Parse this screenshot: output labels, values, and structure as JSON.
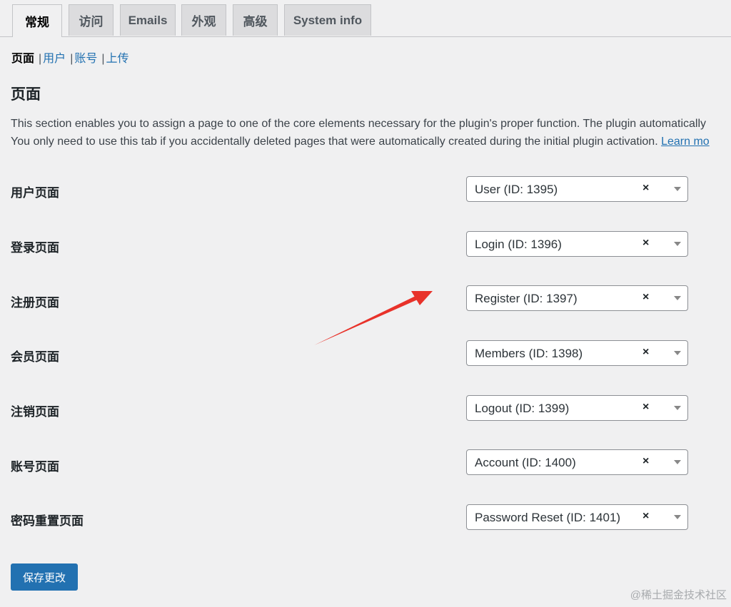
{
  "tabs": [
    "常规",
    "访问",
    "Emails",
    "外观",
    "高级",
    "System info"
  ],
  "subnav": {
    "current": "页面",
    "links": [
      "用户",
      "账号",
      "上传"
    ],
    "separator": "|"
  },
  "section": {
    "title": "页面",
    "desc_line1": "This section enables you to assign a page to one of the core elements necessary for the plugin's proper function. The plugin automatically",
    "desc_line2": "You only need to use this tab if you accidentally deleted pages that were automatically created during the initial plugin activation.",
    "learn_more": "Learn mo"
  },
  "rows": [
    {
      "label": "用户页面",
      "value": "User (ID: 1395)"
    },
    {
      "label": "登录页面",
      "value": "Login (ID: 1396)"
    },
    {
      "label": "注册页面",
      "value": "Register (ID: 1397)"
    },
    {
      "label": "会员页面",
      "value": "Members (ID: 1398)"
    },
    {
      "label": "注销页面",
      "value": "Logout (ID: 1399)"
    },
    {
      "label": "账号页面",
      "value": "Account (ID: 1400)"
    },
    {
      "label": "密码重置页面",
      "value": "Password Reset (ID: 1401)"
    }
  ],
  "clear_glyph": "×",
  "save_label": "保存更改",
  "watermark": "@稀土掘金技术社区",
  "colors": {
    "link": "#2271b1",
    "button": "#2271b1",
    "annotation_arrow": "#e8322a",
    "background": "#f0f0f1"
  }
}
